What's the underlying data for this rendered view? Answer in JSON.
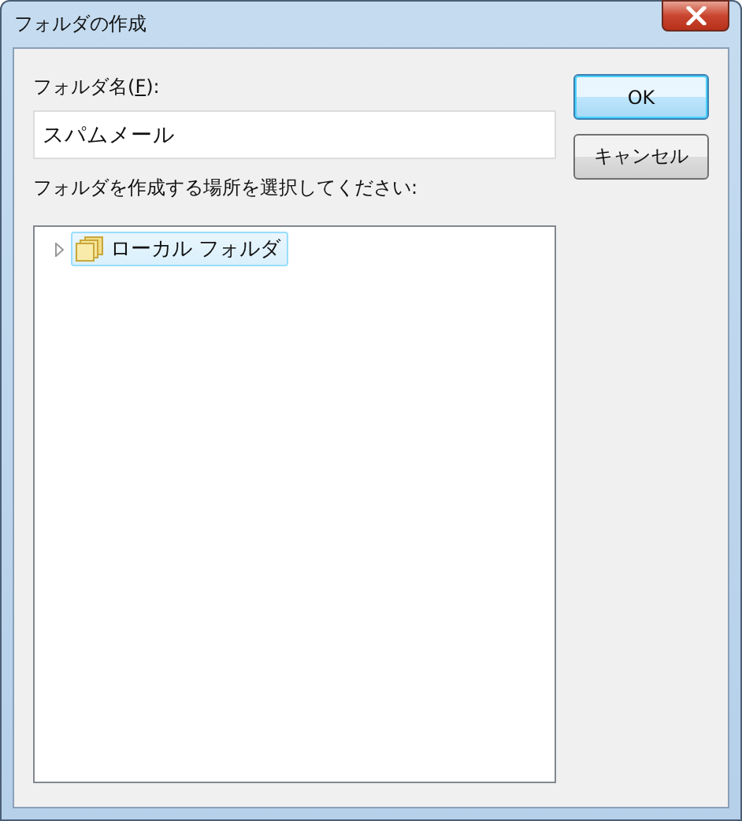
{
  "window": {
    "title": "フォルダの作成"
  },
  "name_label": {
    "before": "フォルダ名(",
    "access_key": "F",
    "after": "):"
  },
  "name_field": {
    "value": "スパムメール"
  },
  "location_label": "フォルダを作成する場所を選択してください:",
  "tree": [
    {
      "label": "ローカル フォルダ",
      "selected": true,
      "expanded": false
    }
  ],
  "buttons": [
    {
      "label": "OK",
      "default": true
    },
    {
      "label": "キャンセル",
      "default": false
    }
  ]
}
